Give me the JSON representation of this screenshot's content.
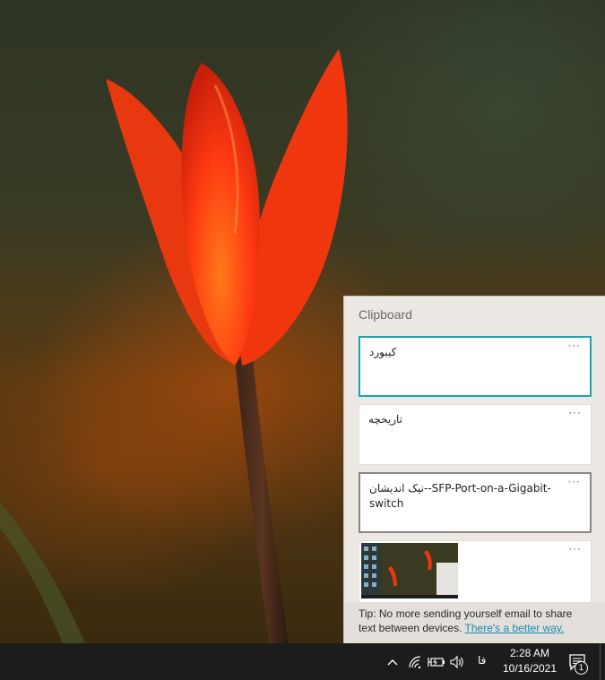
{
  "clipboard": {
    "title": "Clipboard",
    "items": [
      {
        "text": "کیبورد",
        "more": "···"
      },
      {
        "text": "تاریخچه",
        "more": "···"
      },
      {
        "text": "نیک اندیشان--SFP-Port-on-a-Gigabit-switch",
        "more": "···"
      },
      {
        "more": "···"
      }
    ],
    "tip_text": "Tip: No more sending yourself email to share text between devices.",
    "tip_link": "There's a better way."
  },
  "taskbar": {
    "language": "فا",
    "time": "2:28 AM",
    "date": "10/16/2021",
    "notification_count": "1"
  },
  "colors": {
    "accent": "#1aa3b3",
    "link": "#1b8ab0",
    "taskbar": "#1c1c1c"
  }
}
